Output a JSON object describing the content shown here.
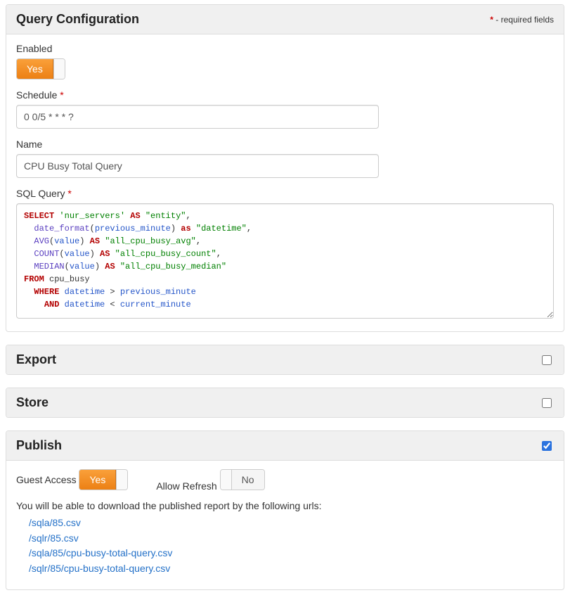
{
  "queryConfig": {
    "title": "Query Configuration",
    "requiredNote": " - required fields",
    "enabled": {
      "label": "Enabled",
      "value": "Yes",
      "on": true
    },
    "schedule": {
      "label": "Schedule",
      "required": true,
      "value": "0 0/5 * * * ?"
    },
    "name": {
      "label": "Name",
      "value": "CPU Busy Total Query"
    },
    "sql": {
      "label": "SQL Query",
      "required": true,
      "code": {
        "line1_kw1": "SELECT",
        "line1_str1": "'nur_servers'",
        "line1_kw2": "AS",
        "line1_str2": "\"entity\"",
        "line1_tail": ",",
        "line2_fn": "date_format",
        "line2_p1": "(",
        "line2_arg": "previous_minute",
        "line2_p2": ")",
        "line2_kw": "as",
        "line2_str": "\"datetime\"",
        "line2_tail": ",",
        "line3_fn": "AVG",
        "line3_p1": "(",
        "line3_arg": "value",
        "line3_p2": ")",
        "line3_kw": "AS",
        "line3_str": "\"all_cpu_busy_avg\"",
        "line3_tail": ",",
        "line4_fn": "COUNT",
        "line4_p1": "(",
        "line4_arg": "value",
        "line4_p2": ")",
        "line4_kw": "AS",
        "line4_str": "\"all_cpu_busy_count\"",
        "line4_tail": ",",
        "line5_fn": "MEDIAN",
        "line5_p1": "(",
        "line5_arg": "value",
        "line5_p2": ")",
        "line5_kw": "AS",
        "line5_str": "\"all_cpu_busy_median\"",
        "line6_kw": "FROM",
        "line6_tbl": " cpu_busy",
        "line7_kw": "WHERE",
        "line7_col": "datetime",
        "line7_op": " > ",
        "line7_val": "previous_minute",
        "line8_kw": "AND",
        "line8_col": "datetime",
        "line8_op": " < ",
        "line8_val": "current_minute"
      }
    }
  },
  "export": {
    "title": "Export",
    "checked": false
  },
  "store": {
    "title": "Store",
    "checked": false
  },
  "publish": {
    "title": "Publish",
    "checked": true,
    "guest": {
      "label": "Guest Access",
      "value": "Yes",
      "on": true
    },
    "refresh": {
      "label": "Allow Refresh",
      "value": "No",
      "on": false
    },
    "note": "You will be able to download the published report by the following urls:",
    "urls": [
      "/sqla/85.csv",
      "/sqlr/85.csv",
      "/sqla/85/cpu-busy-total-query.csv",
      "/sqlr/85/cpu-busy-total-query.csv"
    ]
  }
}
